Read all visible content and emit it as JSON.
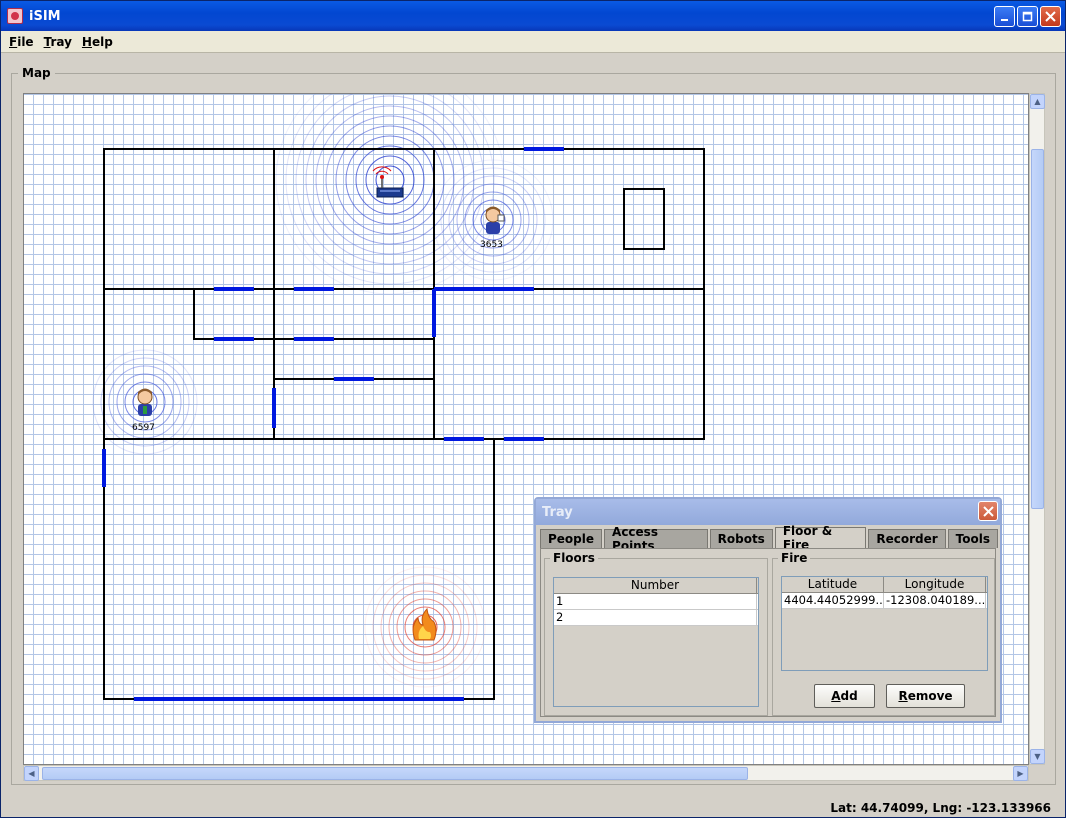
{
  "window": {
    "title": "iSIM",
    "app_icon": "isim-app-icon"
  },
  "menu": {
    "items": [
      {
        "mnemonic": "F",
        "rest": "ile"
      },
      {
        "mnemonic": "T",
        "rest": "ray"
      },
      {
        "mnemonic": "H",
        "rest": "elp"
      }
    ]
  },
  "map": {
    "legend": "Map",
    "people": [
      {
        "id": "3653"
      },
      {
        "id": "6597"
      }
    ],
    "wall_color": "#000000",
    "door_color": "#0018e0",
    "signal_color": "#2a3fd0",
    "fire_color": "#e0392a"
  },
  "status": {
    "text": "Lat: 44.74099,  Lng: -123.133966"
  },
  "tray": {
    "title": "Tray",
    "tabs": [
      {
        "label": "People"
      },
      {
        "label": "Access Points"
      },
      {
        "label": "Robots"
      },
      {
        "label": "Floor & Fire",
        "active": true
      },
      {
        "label": "Recorder"
      },
      {
        "label": "Tools"
      }
    ],
    "floors": {
      "legend": "Floors",
      "column": "Number",
      "rows": [
        "1",
        "2"
      ]
    },
    "fire": {
      "legend": "Fire",
      "columns": [
        "Latitude",
        "Longitude"
      ],
      "rows": [
        [
          "4404.44052999...",
          "-12308.040189..."
        ]
      ],
      "add_mnemonic": "A",
      "add_rest": "dd",
      "remove_mnemonic": "R",
      "remove_rest": "emove"
    }
  }
}
